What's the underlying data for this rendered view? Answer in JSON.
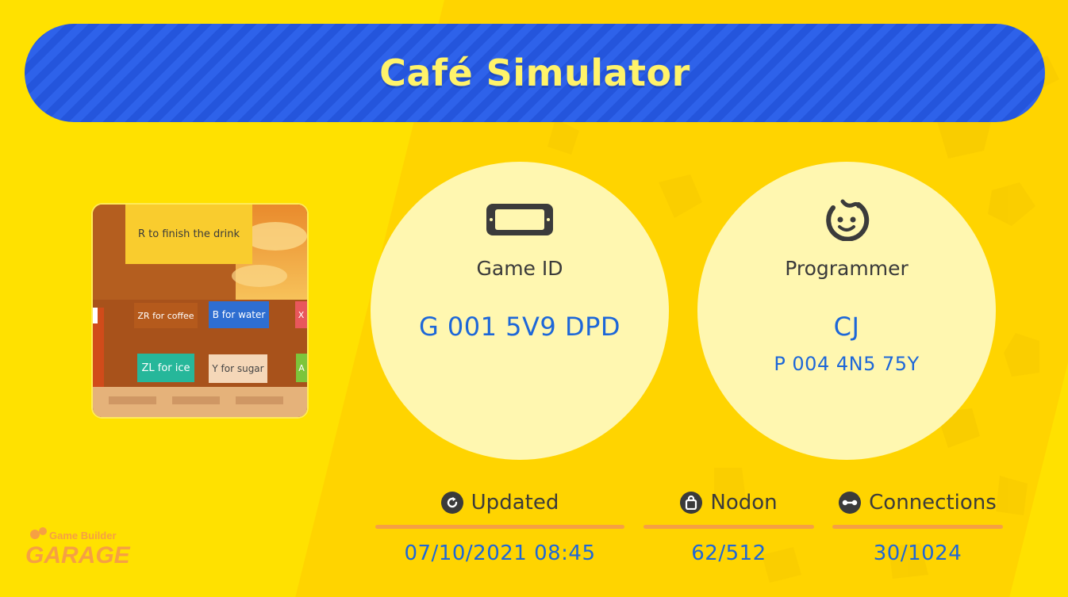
{
  "title": "Café Simulator",
  "thumbnail": {
    "labels": [
      "R to finish the drink",
      "ZR for coffee",
      "B for water",
      "X",
      "ZL for ice",
      "Y for sugar",
      "A"
    ]
  },
  "game_id": {
    "label": "Game ID",
    "value": "G 001 5V9 DPD",
    "icon": "handheld-console-icon"
  },
  "programmer": {
    "label": "Programmer",
    "name": "CJ",
    "id": "P 004 4N5 75Y",
    "icon": "smiley-face-icon"
  },
  "stats": {
    "updated": {
      "label": "Updated",
      "value": "07/10/2021 08:45",
      "icon": "refresh-icon"
    },
    "nodon": {
      "label": "Nodon",
      "value": "62/512",
      "icon": "bag-icon"
    },
    "connections": {
      "label": "Connections",
      "value": "30/1024",
      "icon": "connection-icon"
    }
  },
  "logo": {
    "line1": "Game Builder",
    "line2": "GARAGE"
  },
  "colors": {
    "background": "#ffe100",
    "title_bar": "#2e62ea",
    "title_text": "#fff36a",
    "circle": "#fff7b0",
    "value_text": "#1d67d8",
    "divider": "#f6a043"
  }
}
